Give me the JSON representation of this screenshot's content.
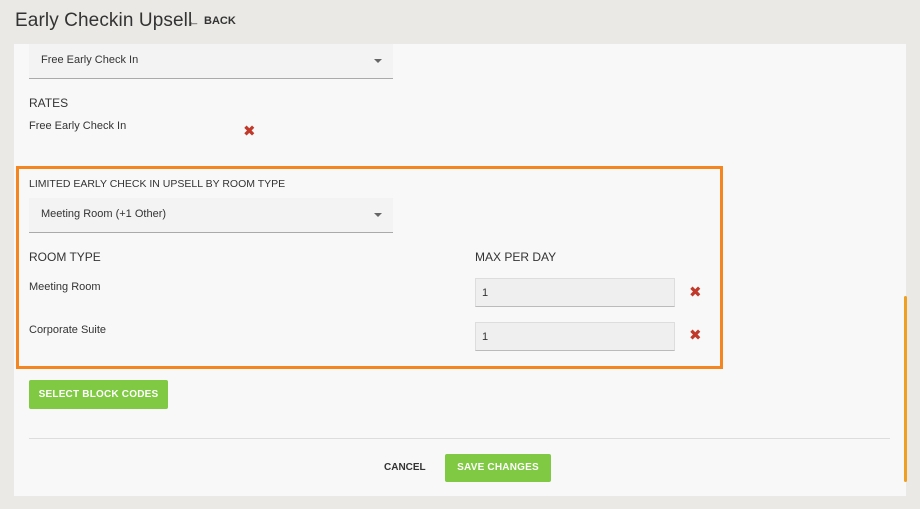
{
  "header": {
    "title": "Early Checkin Upsell",
    "back_label": "BACK",
    "back_icon": "←"
  },
  "upsell_select": {
    "value": "Free Early Check In"
  },
  "rates": {
    "heading": "RATES",
    "items": [
      {
        "label": "Free Early Check In"
      }
    ]
  },
  "limited": {
    "heading": "LIMITED EARLY CHECK IN UPSELL BY ROOM TYPE",
    "select_value": "Meeting Room (+1 Other)",
    "col_room_type": "ROOM TYPE",
    "col_max_per_day": "MAX PER DAY",
    "rows": [
      {
        "room": "Meeting Room",
        "max": "1"
      },
      {
        "room": "Corporate Suite",
        "max": "1"
      }
    ]
  },
  "buttons": {
    "block_codes": "SELECT BLOCK CODES",
    "cancel": "CANCEL",
    "save": "SAVE CHANGES"
  },
  "icons": {
    "remove": "✖"
  },
  "colors": {
    "accent_green": "#7fc943",
    "highlight_orange": "#f5851f",
    "remove_red": "#c0392b"
  }
}
